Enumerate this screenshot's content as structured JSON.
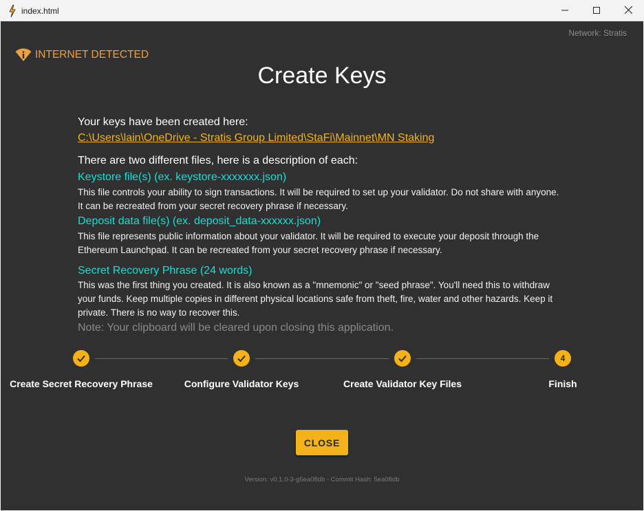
{
  "window": {
    "title": "index.html",
    "icon": "lightning-bolt-icon",
    "controls": [
      "minimize-icon",
      "maximize-icon",
      "close-icon"
    ]
  },
  "header": {
    "network": "Network: Stratis",
    "internet_warning": "INTERNET DETECTED",
    "page_title": "Create Keys"
  },
  "content": {
    "keys_created_label": "Your keys have been created here:",
    "keys_path": "C:\\Users\\lain\\OneDrive - Stratis Group Limited\\StaFi\\Mainnet\\MN Staking",
    "files_intro": "There are two different files, here is a description of each:",
    "keystore_title": "Keystore file(s) (ex. keystore-xxxxxxx.json)",
    "keystore_desc": "This file controls your ability to sign transactions. It will be required to set up your validator. Do not share with anyone. It can be recreated from your secret recovery phrase if necessary.",
    "deposit_title": "Deposit data file(s) (ex. deposit_data-xxxxxx.json)",
    "deposit_desc": "This file represents public information about your validator. It will be required to execute your deposit through the Ethereum Launchpad. It can be recreated from your secret recovery phrase if necessary.",
    "srp_title": "Secret Recovery Phrase (24 words)",
    "srp_desc": "This was the first thing you created. It is also known as a \"mnemonic\" or \"seed phrase\". You'll need this to withdraw your funds. Keep multiple copies in different physical locations safe from theft, fire, water and other hazards. Keep it private. There is no way to recover this.",
    "note": "Note: Your clipboard will be cleared upon closing this application."
  },
  "stepper": {
    "steps": [
      {
        "label": "Create Secret Recovery Phrase",
        "status": "complete",
        "icon": "check-icon"
      },
      {
        "label": "Configure Validator Keys",
        "status": "complete",
        "icon": "check-icon"
      },
      {
        "label": "Create Validator Key Files",
        "status": "complete",
        "icon": "check-icon"
      },
      {
        "label": "Finish",
        "status": "active",
        "number": "4"
      }
    ]
  },
  "actions": {
    "close_label": "CLOSE"
  },
  "footer": {
    "version": "Version: v0.1.0-3-g5ea08db - Commit Hash: 5ea08db"
  },
  "colors": {
    "background": "#303030",
    "accent": "#f3b219",
    "link_teal": "#14e0d8",
    "warning": "#f0a040"
  }
}
